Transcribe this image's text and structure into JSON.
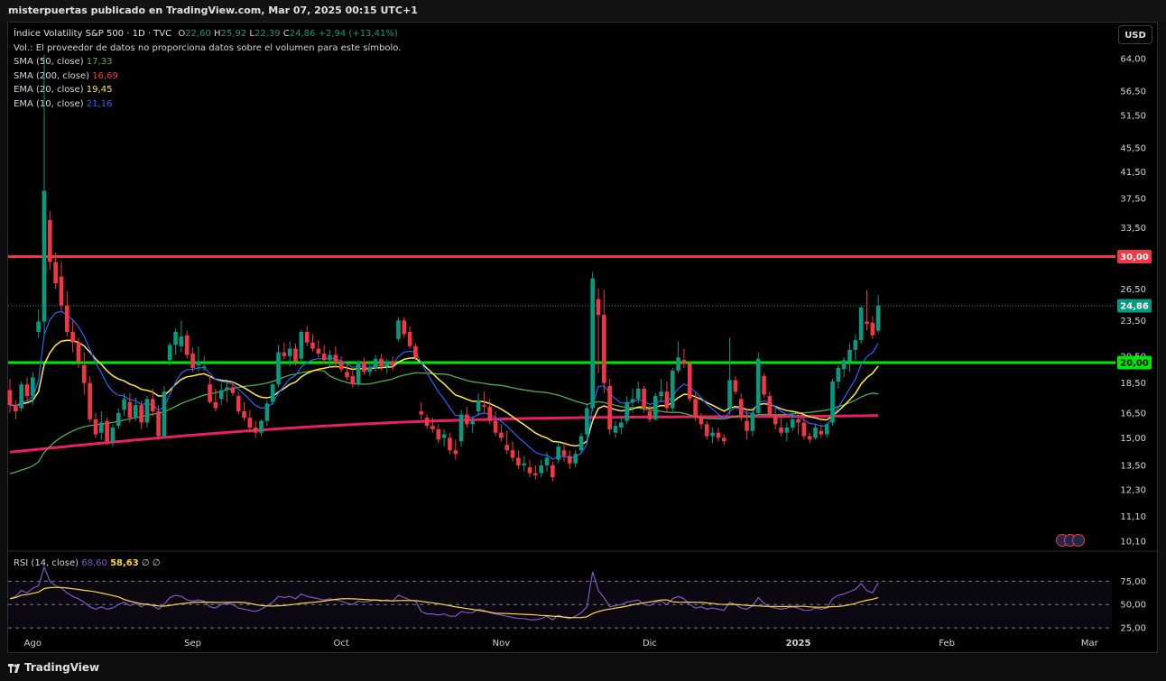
{
  "header": {
    "attribution": "misterpuertas publicado en TradingView.com, Mar 07, 2025 00:15 UTC+1"
  },
  "symbol": {
    "name": "Índice Volatility S&P 500 · 1D · TVC",
    "o_label": "O",
    "o": "22,60",
    "h_label": "H",
    "h": "25,92",
    "l_label": "L",
    "l": "22,39",
    "c_label": "C",
    "c": "24,86",
    "change": "+2,94 (+13,41%)"
  },
  "volume_note": "Vol.: El proveedor de datos no proporciona datos sobre el volumen para este símbolo.",
  "indicators": [
    {
      "label": "SMA (50, close)",
      "value": "17,33",
      "color": "#4caf50"
    },
    {
      "label": "SMA (200, close)",
      "value": "16,69",
      "color": "#f23645"
    },
    {
      "label": "EMA (20, close)",
      "value": "19,45",
      "color": "#ffeb3b"
    },
    {
      "label": "EMA (10, close)",
      "value": "21,16",
      "color": "#2962ff"
    }
  ],
  "currency_button": "USD",
  "price_labels": {
    "resistance": "30,00",
    "last": "24,86",
    "support": "20,00"
  },
  "rsi": {
    "label": "RSI (14, close)",
    "value": "68,60",
    "ma_value": "58,63",
    "extra1": "∅",
    "extra2": "∅",
    "axis": [
      "75,00",
      "50,00",
      "25,00"
    ]
  },
  "footer": {
    "brand": "TradingView"
  },
  "colors": {
    "up": "#089981",
    "down": "#f23645",
    "resistance": "#f23645",
    "support": "#00e600",
    "ema10": "#2962ff",
    "ema20": "#ffeb3b",
    "sma50": "#4caf50",
    "sma200": "#e91e63",
    "rsi": "#7e57c2",
    "rsi_ma": "#fdd835"
  },
  "chart_data": {
    "type": "candlestick",
    "scale": "log",
    "ylim": [
      10.1,
      64
    ],
    "y_ticks": [
      "64,00",
      "56,50",
      "51,50",
      "45,50",
      "41,50",
      "37,50",
      "33,50",
      "26,50",
      "23,50",
      "20,50",
      "18,50",
      "16,50",
      "15,00",
      "13,50",
      "12,30",
      "11,10",
      "10,10"
    ],
    "y_tick_values": [
      64,
      56.5,
      51.5,
      45.5,
      41.5,
      37.5,
      33.5,
      26.5,
      23.5,
      20.5,
      18.5,
      16.5,
      15,
      13.5,
      12.3,
      11.1,
      10.1
    ],
    "x_labels": [
      "Ago",
      "Sep",
      "Oct",
      "Nov",
      "Dic",
      "2025",
      "Feb",
      "Mar"
    ],
    "x_label_index": [
      4,
      32,
      58,
      86,
      112,
      138,
      164,
      189
    ],
    "horizontal_lines": [
      {
        "value": 30
      },
      {
        "value": 20
      }
    ],
    "ohlc": [
      [
        18,
        18.8,
        16.5,
        17
      ],
      [
        17,
        17.3,
        16.1,
        16.6
      ],
      [
        16.8,
        18.6,
        16.6,
        18.4
      ],
      [
        18.4,
        18.9,
        17.3,
        17.6
      ],
      [
        17.6,
        19.3,
        17,
        18.9
      ],
      [
        22.5,
        24.5,
        22,
        23.4
      ],
      [
        23.4,
        65,
        22.1,
        38.6
      ],
      [
        34.5,
        35.7,
        28.5,
        29.4
      ],
      [
        29.4,
        30.5,
        26.5,
        27.1
      ],
      [
        27.8,
        29.5,
        24.3,
        24.9
      ],
      [
        24.9,
        26.3,
        22.1,
        22.5
      ],
      [
        22.5,
        23.5,
        20.8,
        21.6
      ],
      [
        21.6,
        22,
        19.6,
        20.1
      ],
      [
        19.8,
        20.8,
        17.7,
        18.5
      ],
      [
        18.5,
        19,
        15.9,
        16.1
      ],
      [
        16.1,
        16.5,
        15,
        15.2
      ],
      [
        15.3,
        16.6,
        14.9,
        15.9
      ],
      [
        16,
        16.2,
        14.6,
        14.8
      ],
      [
        14.8,
        15.8,
        14.5,
        15.6
      ],
      [
        15.7,
        16.8,
        15.5,
        16.5
      ],
      [
        16.7,
        17.8,
        16.3,
        17.4
      ],
      [
        17.2,
        17.8,
        15.9,
        16.2
      ],
      [
        16.2,
        17.5,
        16,
        17
      ],
      [
        17,
        17.3,
        15.5,
        15.9
      ],
      [
        15.9,
        17.6,
        15.6,
        17.4
      ],
      [
        17.4,
        18.1,
        16.3,
        16.6
      ],
      [
        16.6,
        17,
        14.9,
        15.1
      ],
      [
        15.1,
        18.3,
        15,
        17.9
      ],
      [
        20.2,
        21.6,
        19.8,
        21.4
      ],
      [
        21.4,
        22.8,
        20.6,
        22.5
      ],
      [
        21.3,
        23.5,
        20.8,
        22.1
      ],
      [
        22.2,
        22.6,
        20.3,
        20.6
      ],
      [
        20.7,
        21.2,
        19.3,
        19.6
      ],
      [
        19.8,
        21.3,
        19.3,
        20.1
      ],
      [
        19.6,
        20.5,
        19.4,
        19.7
      ],
      [
        18.4,
        19,
        17.1,
        17.2
      ],
      [
        17.2,
        18.1,
        16.6,
        16.8
      ],
      [
        17.4,
        18.5,
        17,
        18
      ],
      [
        18,
        18.6,
        17.2,
        18.2
      ],
      [
        18.2,
        18.6,
        17.6,
        17.8
      ],
      [
        17.6,
        17.9,
        16.4,
        16.6
      ],
      [
        16.6,
        17.2,
        16,
        16.2
      ],
      [
        16.2,
        16.7,
        15.3,
        15.6
      ],
      [
        15.6,
        16,
        15,
        15.3
      ],
      [
        15.3,
        16.1,
        15.1,
        16
      ],
      [
        16,
        17.3,
        15.7,
        17.1
      ],
      [
        17.2,
        18.5,
        17,
        18.4
      ],
      [
        18.4,
        21.4,
        18.2,
        20.8
      ],
      [
        20.8,
        21.6,
        20.2,
        20.5
      ],
      [
        20.5,
        21.7,
        19.7,
        21.1
      ],
      [
        21.1,
        21.5,
        19.8,
        20.1
      ],
      [
        20.3,
        22.7,
        20,
        22.5
      ],
      [
        22.5,
        23,
        21.3,
        21.6
      ],
      [
        21.6,
        22.3,
        20.9,
        21.1
      ],
      [
        21.1,
        21.8,
        20.4,
        20.7
      ],
      [
        20.7,
        21.4,
        19.9,
        20.2
      ],
      [
        20.2,
        21,
        19.6,
        20.6
      ],
      [
        20.6,
        21.3,
        19.6,
        20
      ],
      [
        20.1,
        20.5,
        19.3,
        19.5
      ],
      [
        19.3,
        19.9,
        18.7,
        18.9
      ],
      [
        19,
        19.4,
        18.2,
        18.4
      ],
      [
        18.4,
        20.2,
        18.3,
        20.1
      ],
      [
        20.1,
        20.4,
        19.1,
        19.3
      ],
      [
        19.3,
        20.1,
        19,
        19.6
      ],
      [
        19.6,
        20.6,
        19.3,
        20.3
      ],
      [
        20.3,
        20.7,
        19.4,
        19.7
      ],
      [
        19.7,
        20.3,
        19.2,
        20.1
      ],
      [
        20.1,
        20.5,
        19.4,
        19.8
      ],
      [
        21.9,
        23.8,
        21.7,
        23.5
      ],
      [
        23.5,
        23.8,
        22,
        22.3
      ],
      [
        22.5,
        23,
        21.1,
        21.3
      ],
      [
        21.3,
        21.5,
        20.2,
        20.4
      ],
      [
        16.6,
        17.2,
        16.1,
        16.4
      ],
      [
        16.2,
        16.4,
        15.5,
        15.7
      ],
      [
        15.7,
        16.2,
        15.3,
        15.5
      ],
      [
        15.5,
        15.8,
        14.7,
        14.9
      ],
      [
        15,
        15.5,
        14.5,
        15.2
      ],
      [
        15,
        15.3,
        14.1,
        14.3
      ],
      [
        14.3,
        14.9,
        13.8,
        14.1
      ],
      [
        14.8,
        16.7,
        14.5,
        16.4
      ],
      [
        16.4,
        16.9,
        15.6,
        15.8
      ],
      [
        15.8,
        16.3,
        15.3,
        16
      ],
      [
        16.6,
        17.8,
        16.3,
        17.3
      ],
      [
        17,
        17.9,
        16.5,
        16.9
      ],
      [
        16.9,
        17.4,
        15.8,
        16
      ],
      [
        16,
        16.6,
        15.1,
        15.3
      ],
      [
        15.3,
        15.8,
        14.8,
        15
      ],
      [
        14.6,
        15.4,
        14.1,
        14.3
      ],
      [
        14.3,
        14.8,
        13.7,
        13.9
      ],
      [
        13.9,
        14.3,
        13.3,
        13.5
      ],
      [
        13.5,
        14,
        13.2,
        13.6
      ],
      [
        13.4,
        13.8,
        12.9,
        13.1
      ],
      [
        13.1,
        13.5,
        12.8,
        13
      ],
      [
        13.1,
        13.8,
        12.9,
        13.5
      ],
      [
        13.5,
        14.2,
        13.2,
        13.9
      ],
      [
        13.5,
        13.7,
        12.7,
        12.9
      ],
      [
        13.8,
        14.8,
        13.6,
        14.5
      ],
      [
        14.3,
        14.7,
        13.7,
        14
      ],
      [
        14,
        14.3,
        13.3,
        13.6
      ],
      [
        13.6,
        14.3,
        13.4,
        14.1
      ],
      [
        14.3,
        15.3,
        14.1,
        15.1
      ],
      [
        15.2,
        17,
        15,
        16.8
      ],
      [
        16.8,
        28.3,
        16.6,
        27.6
      ],
      [
        25.5,
        26.6,
        19.2,
        24
      ],
      [
        24,
        26.4,
        17.8,
        18.5
      ],
      [
        18.3,
        18.8,
        15.2,
        15.5
      ],
      [
        15.3,
        16,
        15,
        15.7
      ],
      [
        15.6,
        16.3,
        15.2,
        15.9
      ],
      [
        16,
        17.6,
        15.8,
        17.2
      ],
      [
        17.2,
        18.1,
        16.5,
        17.4
      ],
      [
        17.4,
        18.6,
        17.1,
        18.1
      ],
      [
        18.1,
        18.3,
        16.5,
        16.8
      ],
      [
        16.6,
        17,
        15.9,
        16.1
      ],
      [
        16.1,
        17.8,
        16,
        17.6
      ],
      [
        17.6,
        18.8,
        17.2,
        17.9
      ],
      [
        17.9,
        18.6,
        16.5,
        16.8
      ],
      [
        16.8,
        19.6,
        16.6,
        19.4
      ],
      [
        19.4,
        21.7,
        19.2,
        20.4
      ],
      [
        20.2,
        21.1,
        19.6,
        19.9
      ],
      [
        19.9,
        20.1,
        17.2,
        17.4
      ],
      [
        17.4,
        17.8,
        16,
        16.2
      ],
      [
        16.2,
        16.5,
        15.5,
        15.8
      ],
      [
        15.8,
        16,
        14.9,
        15.1
      ],
      [
        15.1,
        15.6,
        14.7,
        15.3
      ],
      [
        15.3,
        15.6,
        14.8,
        15
      ],
      [
        15,
        15.2,
        14.6,
        14.8
      ],
      [
        16.8,
        22,
        16.4,
        18.7
      ],
      [
        18.7,
        19,
        17.7,
        17.9
      ],
      [
        17.4,
        17.8,
        16,
        16.2
      ],
      [
        16,
        16.8,
        14.9,
        15.4
      ],
      [
        15.4,
        16.6,
        15.1,
        16.5
      ],
      [
        16.5,
        20.8,
        16.3,
        20.3
      ],
      [
        19,
        19.2,
        17.5,
        17.7
      ],
      [
        17.6,
        17.9,
        16.2,
        16.4
      ],
      [
        16.4,
        16.8,
        15.5,
        15.8
      ],
      [
        15.6,
        16.4,
        15.1,
        15.3
      ],
      [
        15.3,
        15.9,
        14.8,
        15.6
      ],
      [
        15.6,
        16.5,
        15.4,
        16.1
      ],
      [
        16.1,
        16.6,
        15.2,
        15.9
      ],
      [
        15.9,
        16.3,
        14.9,
        15.1
      ],
      [
        15.1,
        15.3,
        14.7,
        14.9
      ],
      [
        15,
        15.8,
        14.9,
        15.6
      ],
      [
        15.4,
        15.8,
        15,
        15.2
      ],
      [
        15.2,
        15.9,
        15,
        15.8
      ],
      [
        15.9,
        18.8,
        15.7,
        18.6
      ],
      [
        18.6,
        19.8,
        18.1,
        19.6
      ],
      [
        19.5,
        20.4,
        18.9,
        20.2
      ],
      [
        20.1,
        21.5,
        19.3,
        21
      ],
      [
        21,
        22.3,
        20.2,
        21.8
      ],
      [
        21.8,
        24.9,
        21.5,
        24.7
      ],
      [
        23.4,
        26.4,
        22.6,
        23.2
      ],
      [
        23.3,
        23.9,
        21.9,
        22.2
      ],
      [
        22.6,
        25.9,
        22.4,
        24.86
      ]
    ],
    "series": [
      {
        "name": "EMA (10, close)",
        "values": []
      },
      {
        "name": "EMA (20, close)",
        "values": []
      },
      {
        "name": "SMA (50, close)",
        "values": []
      },
      {
        "name": "SMA (200, close)",
        "values": []
      }
    ],
    "rsi_values": [
      55,
      57,
      62,
      60,
      64,
      66,
      82,
      70,
      66,
      64,
      60,
      57,
      55,
      52,
      48,
      46,
      48,
      46,
      47,
      50,
      52,
      49,
      51,
      48,
      51,
      49,
      46,
      50,
      56,
      58,
      57,
      54,
      53,
      54,
      53,
      48,
      47,
      50,
      51,
      50,
      47,
      46,
      45,
      44,
      46,
      49,
      52,
      57,
      56,
      57,
      55,
      59,
      57,
      56,
      55,
      54,
      55,
      54,
      53,
      51,
      50,
      53,
      52,
      53,
      54,
      53,
      54,
      53,
      58,
      56,
      54,
      53,
      44,
      42,
      42,
      41,
      42,
      40,
      40,
      44,
      43,
      43,
      46,
      45,
      43,
      42,
      41,
      40,
      39,
      38,
      38,
      37,
      37,
      38,
      40,
      37,
      41,
      39,
      38,
      40,
      43,
      48,
      78,
      62,
      56,
      48,
      49,
      50,
      52,
      53,
      54,
      50,
      49,
      52,
      53,
      50,
      55,
      57,
      55,
      50,
      47,
      48,
      46,
      47,
      46,
      45,
      52,
      50,
      47,
      46,
      49,
      56,
      51,
      48,
      47,
      46,
      47,
      48,
      47,
      45,
      45,
      47,
      46,
      47,
      55,
      58,
      59,
      61,
      63,
      68,
      62,
      60,
      68.6
    ],
    "rsi_ma_values": []
  }
}
